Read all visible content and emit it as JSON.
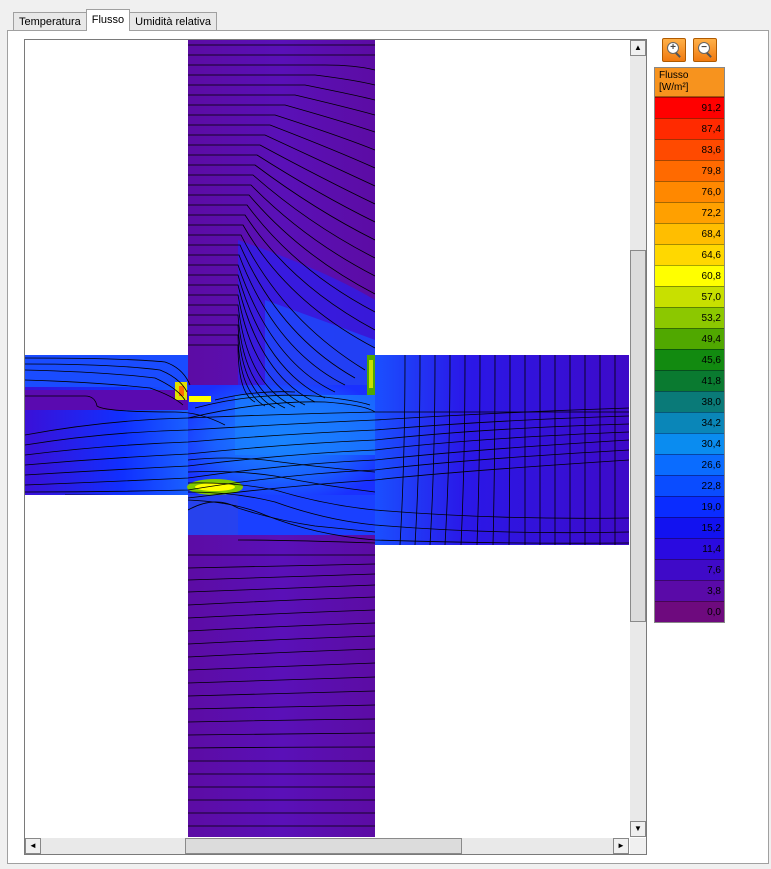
{
  "tabs": [
    {
      "label": "Temperatura",
      "active": false
    },
    {
      "label": "Flusso",
      "active": true
    },
    {
      "label": "Umidità relativa",
      "active": false
    }
  ],
  "toolbar": {
    "zoom_in_icon": "zoom-in-icon",
    "zoom_out_icon": "zoom-out-icon"
  },
  "legend": {
    "title": "Flusso",
    "unit": "[W/m²]",
    "entries": [
      {
        "value": "91,2",
        "color": "#ff0000"
      },
      {
        "value": "87,4",
        "color": "#ff2a00"
      },
      {
        "value": "83,6",
        "color": "#ff4a00"
      },
      {
        "value": "79,8",
        "color": "#ff6a00"
      },
      {
        "value": "76,0",
        "color": "#ff8800"
      },
      {
        "value": "72,2",
        "color": "#ffa000"
      },
      {
        "value": "68,4",
        "color": "#ffbe00"
      },
      {
        "value": "64,6",
        "color": "#ffd800"
      },
      {
        "value": "60,8",
        "color": "#ffff00"
      },
      {
        "value": "57,0",
        "color": "#c8e000"
      },
      {
        "value": "53,2",
        "color": "#8cc800"
      },
      {
        "value": "49,4",
        "color": "#50a800"
      },
      {
        "value": "45,6",
        "color": "#128a10"
      },
      {
        "value": "41,8",
        "color": "#0a7a30"
      },
      {
        "value": "38,0",
        "color": "#0a7a78"
      },
      {
        "value": "34,2",
        "color": "#0a86b8"
      },
      {
        "value": "30,4",
        "color": "#0a8cf0"
      },
      {
        "value": "26,6",
        "color": "#0a6cff"
      },
      {
        "value": "22,8",
        "color": "#0a4cff"
      },
      {
        "value": "19,0",
        "color": "#0a2cff"
      },
      {
        "value": "15,2",
        "color": "#1212f0"
      },
      {
        "value": "11,4",
        "color": "#2a0ae0"
      },
      {
        "value": "7,6",
        "color": "#3f0ac8"
      },
      {
        "value": "3,8",
        "color": "#5a0aa8"
      },
      {
        "value": "0,0",
        "color": "#6e0a7e"
      }
    ]
  },
  "scrollbars": {
    "vertical_position": 0.28,
    "horizontal_position": 0.26
  }
}
